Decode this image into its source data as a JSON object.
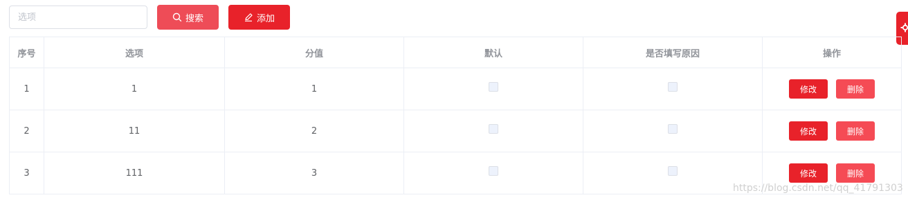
{
  "toolbar": {
    "search_placeholder": "选项",
    "search_label": "搜索",
    "add_label": "添加"
  },
  "table": {
    "headers": [
      "序号",
      "选项",
      "分值",
      "默认",
      "是否填写原因",
      "操作"
    ],
    "rows": [
      {
        "index": "1",
        "option": "1",
        "score": "1",
        "default_checked": false,
        "reason_checked": false
      },
      {
        "index": "2",
        "option": "11",
        "score": "2",
        "default_checked": false,
        "reason_checked": false
      },
      {
        "index": "3",
        "option": "111",
        "score": "3",
        "default_checked": false,
        "reason_checked": false
      }
    ],
    "edit_label": "修改",
    "delete_label": "删除"
  },
  "watermark": "https://blog.csdn.net/qq_41791303",
  "colors": {
    "primary": "#e8222a",
    "search_button": "#ee4c57",
    "delete_button": "#f54b55",
    "border": "#ebeef5"
  },
  "icons": {
    "search": "search-icon",
    "add": "edit-pen-icon",
    "side_tab": "gear-icon"
  }
}
